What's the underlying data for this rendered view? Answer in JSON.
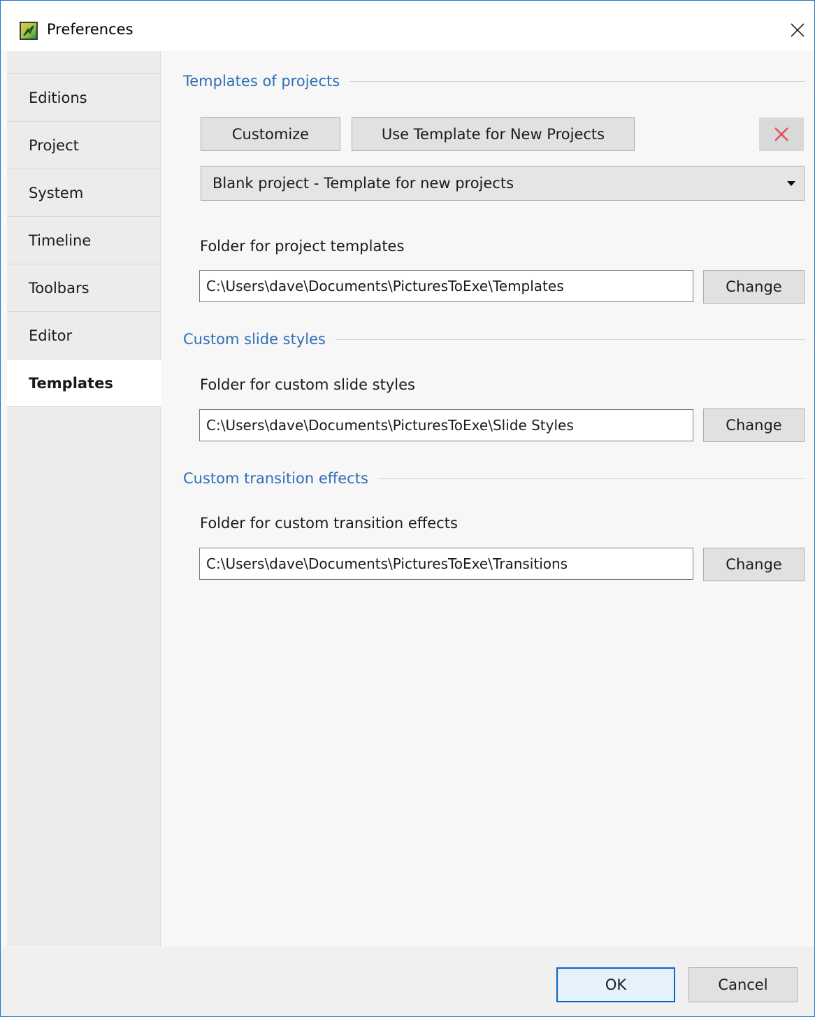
{
  "window": {
    "title": "Preferences",
    "app_icon": "pte-app-icon",
    "close_icon": "close-icon"
  },
  "sidebar": {
    "items": [
      {
        "label": "Editions"
      },
      {
        "label": "Project"
      },
      {
        "label": "System"
      },
      {
        "label": "Timeline"
      },
      {
        "label": "Toolbars"
      },
      {
        "label": "Editor"
      },
      {
        "label": "Templates",
        "active": true
      }
    ]
  },
  "templates_section": {
    "header": "Templates of projects",
    "customize_label": "Customize",
    "use_template_label": "Use Template for New Projects",
    "remove_icon": "red-x-icon",
    "selected_template": "Blank project - Template for new projects",
    "folder_label": "Folder for project templates",
    "folder_value": "C:\\Users\\dave\\Documents\\PicturesToExe\\Templates",
    "change_label": "Change"
  },
  "slide_styles_section": {
    "header": "Custom slide styles",
    "folder_label": "Folder for custom slide styles",
    "folder_value": "C:\\Users\\dave\\Documents\\PicturesToExe\\Slide Styles",
    "change_label": "Change"
  },
  "transitions_section": {
    "header": "Custom transition effects",
    "folder_label": "Folder for custom transition effects",
    "folder_value": "C:\\Users\\dave\\Documents\\PicturesToExe\\Transitions",
    "change_label": "Change"
  },
  "footer": {
    "ok_label": "OK",
    "cancel_label": "Cancel"
  },
  "colors": {
    "window_border": "#1e78c8",
    "section_header": "#2e6fb7",
    "remove_icon": "#e0525a",
    "ok_border": "#0a64c8"
  }
}
